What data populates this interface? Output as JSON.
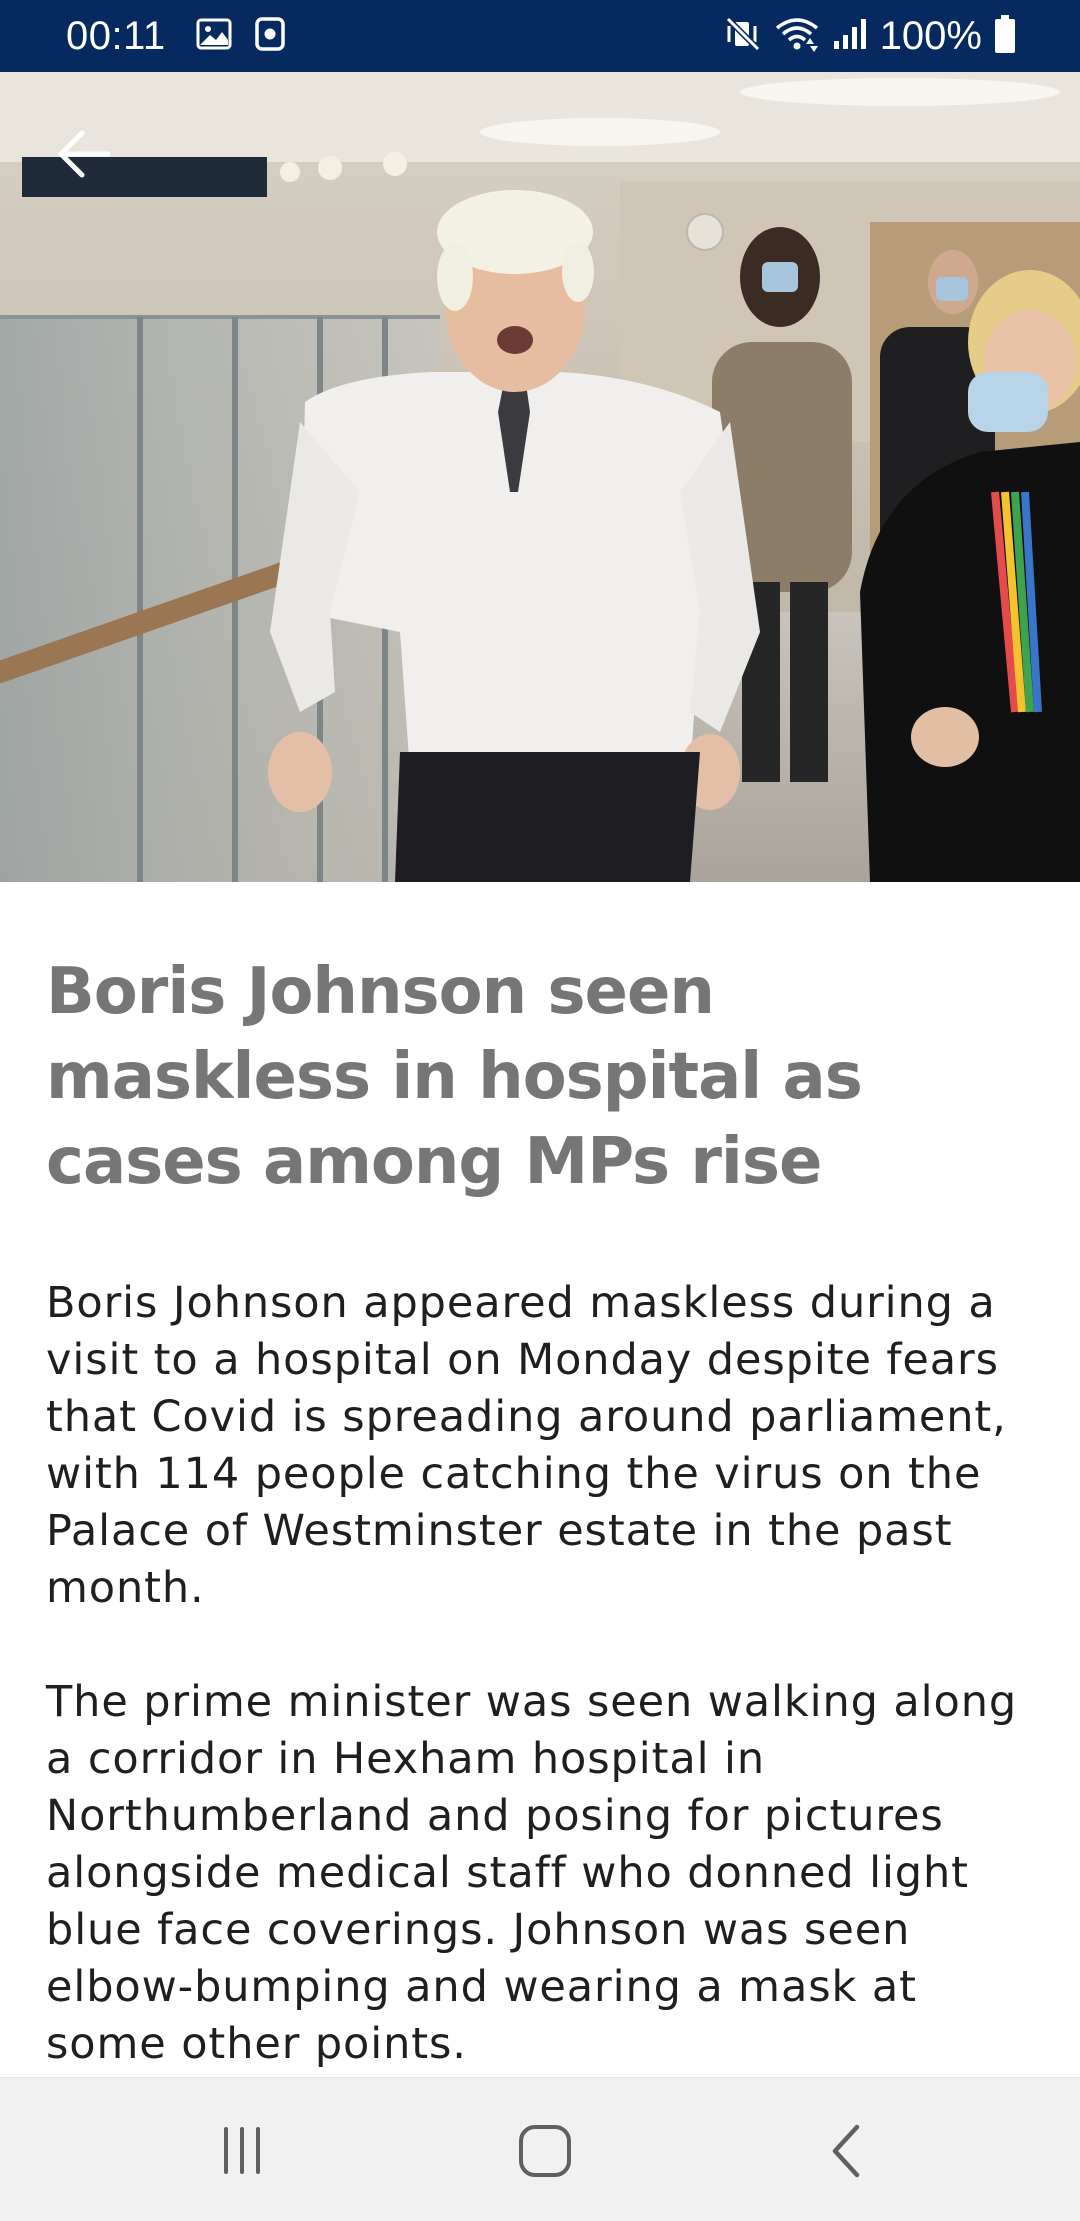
{
  "status_bar": {
    "time": "00:11",
    "battery": "100%",
    "icons": [
      "gallery-icon",
      "screen-record-icon",
      "mute-vibrate-icon",
      "wifi-icon",
      "signal-icon",
      "battery-icon"
    ]
  },
  "hero": {
    "image": "photo-boris-johnson-hospital-corridor",
    "back_icon": "arrow-left-icon"
  },
  "article": {
    "headline": "Boris Johnson seen maskless in hospital as cases among MPs rise",
    "paragraphs": [
      "Boris Johnson appeared maskless during a visit to a hospital on Monday despite fears that Covid is spreading around parliament, with 114 people catching the virus on the Palace of Westminster estate in the past month.",
      "The prime minister was seen walking along a corridor in Hexham hospital in Northumberland and posing for pictures alongside medical staff who donned light blue face coverings. Johnson was seen elbow-bumping and wearing a mask at some other points."
    ]
  },
  "nav_bar": {
    "icons": [
      "recent-apps-icon",
      "home-icon",
      "back-icon"
    ]
  },
  "colors": {
    "status_bar": "#062a5f",
    "headline": "#767676",
    "body_text": "#1f1f1f",
    "nav_bar": "#f1f1f1"
  }
}
